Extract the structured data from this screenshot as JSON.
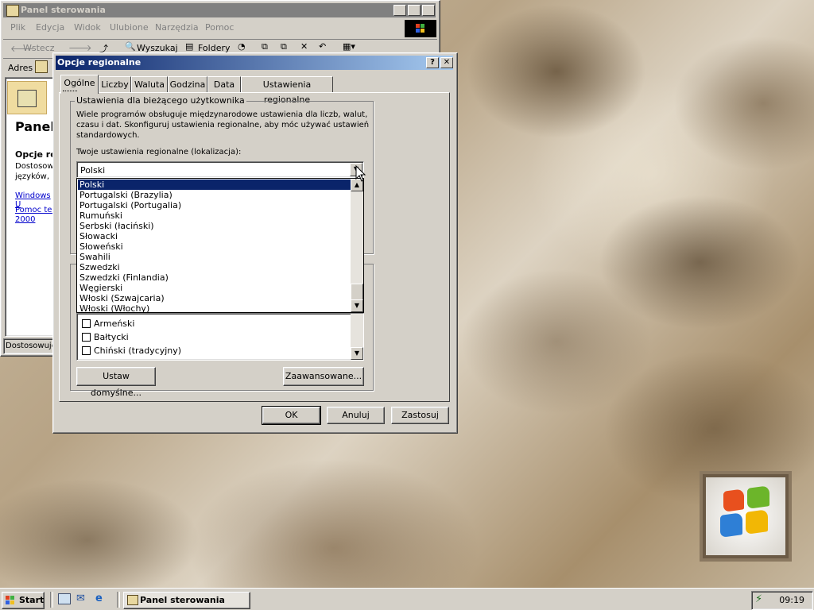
{
  "background_window": {
    "title": "Panel sterowania",
    "menu": [
      "Plik",
      "Edycja",
      "Widok",
      "Ulubione",
      "Narzędzia",
      "Pomoc"
    ],
    "toolbar": {
      "back": "Wstecz",
      "search": "Wyszukaj",
      "folders": "Foldery"
    },
    "address_label": "Adres",
    "side_panel": {
      "title": "Panel",
      "heading": "Opcje re",
      "text_line1": "Dostosow",
      "text_line2": "języków, l",
      "link1": "Windows U",
      "link2_line1": "Pomoc tec",
      "link2_line2": "2000"
    },
    "status": "Dostosowuje"
  },
  "dialog": {
    "title": "Opcje regionalne",
    "help_btn": "?",
    "close_btn": "✕",
    "tabs": [
      "Ogólne",
      "Liczby",
      "Waluta",
      "Godzina",
      "Data",
      "Ustawienia regionalne"
    ],
    "group1_label": "Ustawienia dla bieżącego użytkownika",
    "description_line1": "Wiele programów obsługuje międzynarodowe ustawienia dla liczb, walut,",
    "description_line2": "czasu i dat. Skonfiguruj ustawienia regionalne, aby móc używać ustawień",
    "description_line3": "standardowych.",
    "locale_label": "Twoje ustawienia regionalne (lokalizacja):",
    "locale_value": "Polski",
    "dropdown_items": [
      "Polski",
      "Portugalski (Brazylia)",
      "Portugalski (Portugalia)",
      "Rumuński",
      "Serbski (łaciński)",
      "Słowacki",
      "Słoweński",
      "Swahili",
      "Szwedzki",
      "Szwedzki (Finlandia)",
      "Węgierski",
      "Włoski (Szwajcaria)",
      "Włoski (Włochy)"
    ],
    "selected_index": 0,
    "language_items": [
      "Armeński",
      "Bałtycki",
      "Chiński (tradycyjny)"
    ],
    "set_default_btn": "Ustaw domyślne...",
    "advanced_btn": "Zaawansowane...",
    "ok_btn": "OK",
    "cancel_btn": "Anuluj",
    "apply_btn": "Zastosuj"
  },
  "taskbar": {
    "start": "Start",
    "task_label": "Panel sterowania",
    "clock": "09:19"
  },
  "colors": {
    "title_active_start": "#0a246a",
    "title_active_end": "#a6caf0",
    "title_inactive": "#808080",
    "selection": "#0a246a",
    "face": "#d4d0c8"
  }
}
